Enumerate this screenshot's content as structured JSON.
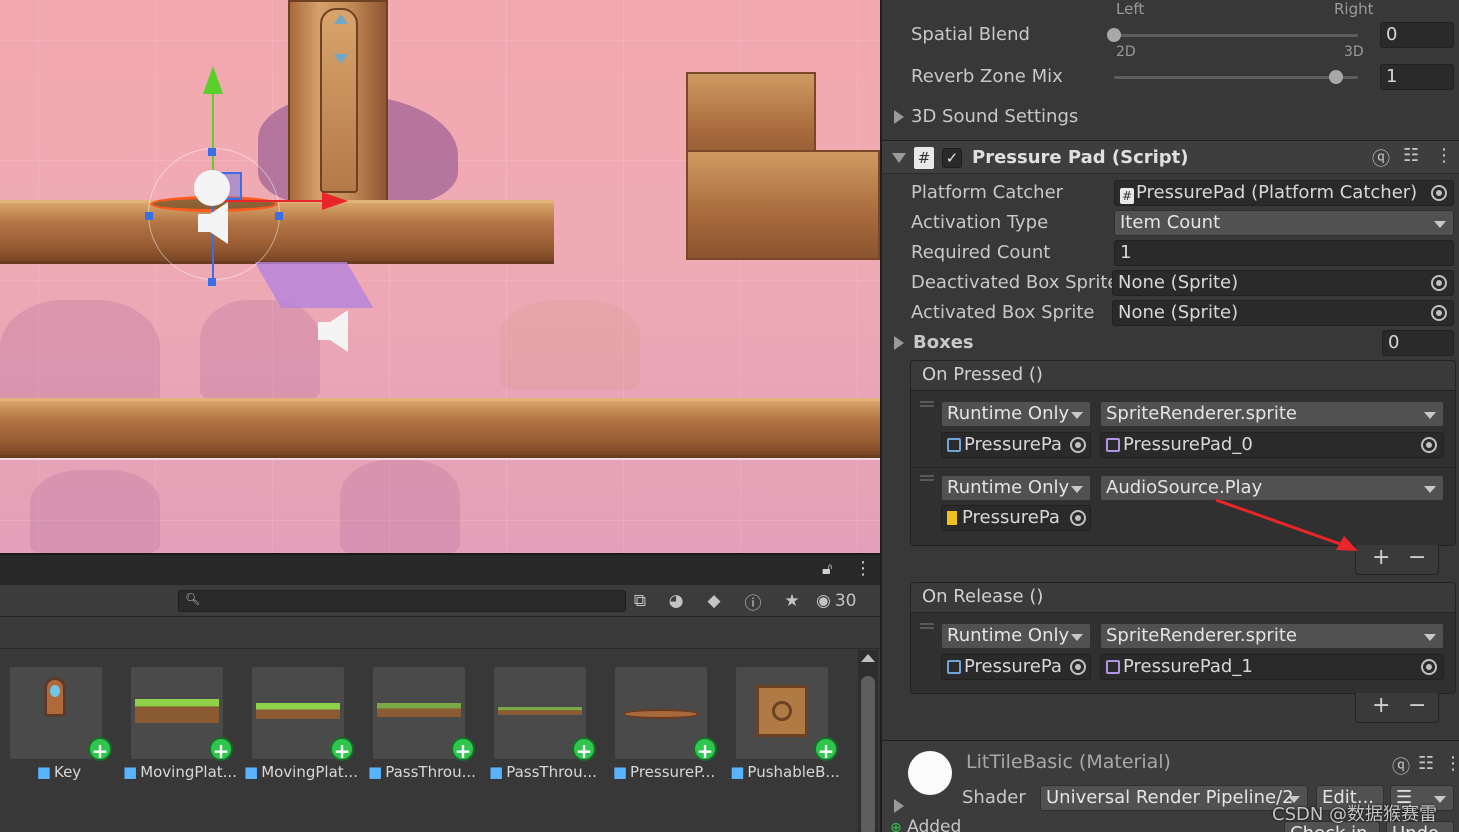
{
  "scene": {},
  "project": {
    "visibility_count": "30",
    "assets": [
      {
        "label": "Key"
      },
      {
        "label": "MovingPlat..."
      },
      {
        "label": "MovingPlat..."
      },
      {
        "label": "PassThrou..."
      },
      {
        "label": "PassThrou..."
      },
      {
        "label": "PressureP..."
      },
      {
        "label": "PushableB..."
      }
    ]
  },
  "inspector": {
    "audio": {
      "pan_left": "Left",
      "pan_right": "Right",
      "spatial_blend_label": "Spatial Blend",
      "spatial_blend_value": "0",
      "spatial_min": "2D",
      "spatial_max": "3D",
      "spatial_blend_fraction": 0,
      "reverb_label": "Reverb Zone Mix",
      "reverb_value": "1",
      "reverb_fraction": 0.91,
      "sound_settings_label": "3D Sound Settings"
    },
    "component": {
      "title": "Pressure Pad (Script)",
      "enabled": true,
      "fields": {
        "platform_catcher_label": "Platform Catcher",
        "platform_catcher_value": "PressurePad (Platform Catcher)",
        "activation_type_label": "Activation Type",
        "activation_type_value": "Item Count",
        "required_count_label": "Required Count",
        "required_count_value": "1",
        "deactivated_sprite_label": "Deactivated Box Sprite",
        "deactivated_sprite_value": "None (Sprite)",
        "activated_sprite_label": "Activated Box Sprite",
        "activated_sprite_value": "None (Sprite)",
        "boxes_label": "Boxes",
        "boxes_value": "0"
      },
      "on_pressed": {
        "title": "On Pressed ()",
        "entries": [
          {
            "mode": "Runtime Only",
            "function": "SpriteRenderer.sprite",
            "object": "PressurePa",
            "argument": "PressurePad_0"
          },
          {
            "mode": "Runtime Only",
            "function": "AudioSource.Play",
            "object": "PressurePa"
          }
        ]
      },
      "on_release": {
        "title": "On Release ()",
        "entries": [
          {
            "mode": "Runtime Only",
            "function": "SpriteRenderer.sprite",
            "object": "PressurePa",
            "argument": "PressurePad_1"
          }
        ]
      },
      "plus": "+",
      "minus": "−"
    },
    "material": {
      "title": "LitTileBasic (Material)",
      "shader_label": "Shader",
      "shader_value": "Universal Render Pipeline/2",
      "edit_button": "Edit...",
      "added_label": "Added",
      "check_in": "Check in",
      "undo": "Undo"
    }
  },
  "watermark": "CSDN @数据猴赛雷",
  "colors": {
    "accent_plus": "#2fc64d",
    "arrow_red": "#e8262a",
    "gizmo_green": "#5ad12a",
    "gizmo_blue": "#3a6fe8"
  }
}
